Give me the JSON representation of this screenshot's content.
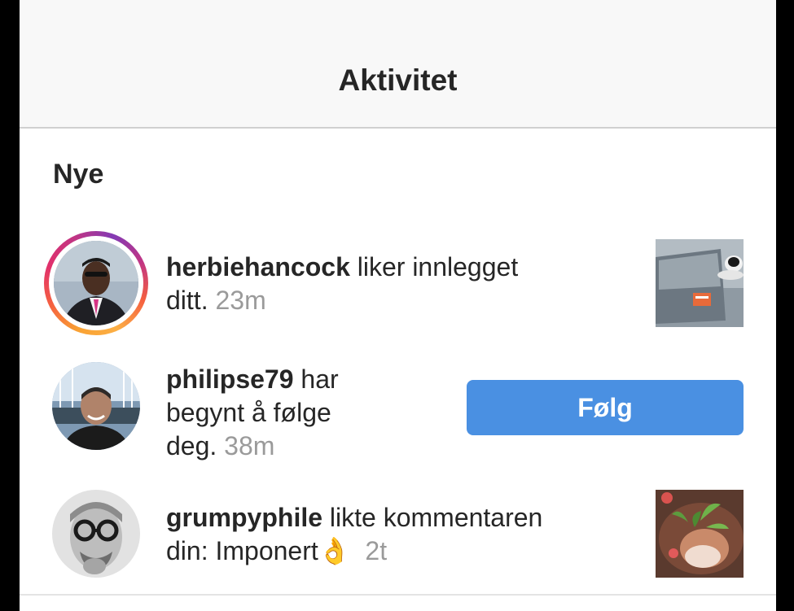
{
  "header": {
    "title": "Aktivitet"
  },
  "section": {
    "title": "Nye"
  },
  "items": [
    {
      "username": "herbiehancock",
      "action": " liker innlegget",
      "action_line2": "ditt.",
      "time": "23m",
      "avatar_icon": "user-avatar-icon",
      "thumbnail_icon": "post-thumbnail-icon"
    },
    {
      "username": "philipse79",
      "action": " har",
      "action_line2": "begynt å følge",
      "action_line3": "deg.",
      "time": "38m",
      "avatar_icon": "user-avatar-icon",
      "button_label": "Følg"
    },
    {
      "username": "grumpyphile",
      "action": " likte kommentaren",
      "action_line2": "din: Imponert",
      "emoji": "👌",
      "time": "2t",
      "avatar_icon": "user-avatar-icon",
      "thumbnail_icon": "post-thumbnail-icon"
    }
  ],
  "colors": {
    "accent": "#4a90e2",
    "text": "#262626",
    "muted": "#9a9a9a",
    "header_bg": "#f8f8f8"
  }
}
